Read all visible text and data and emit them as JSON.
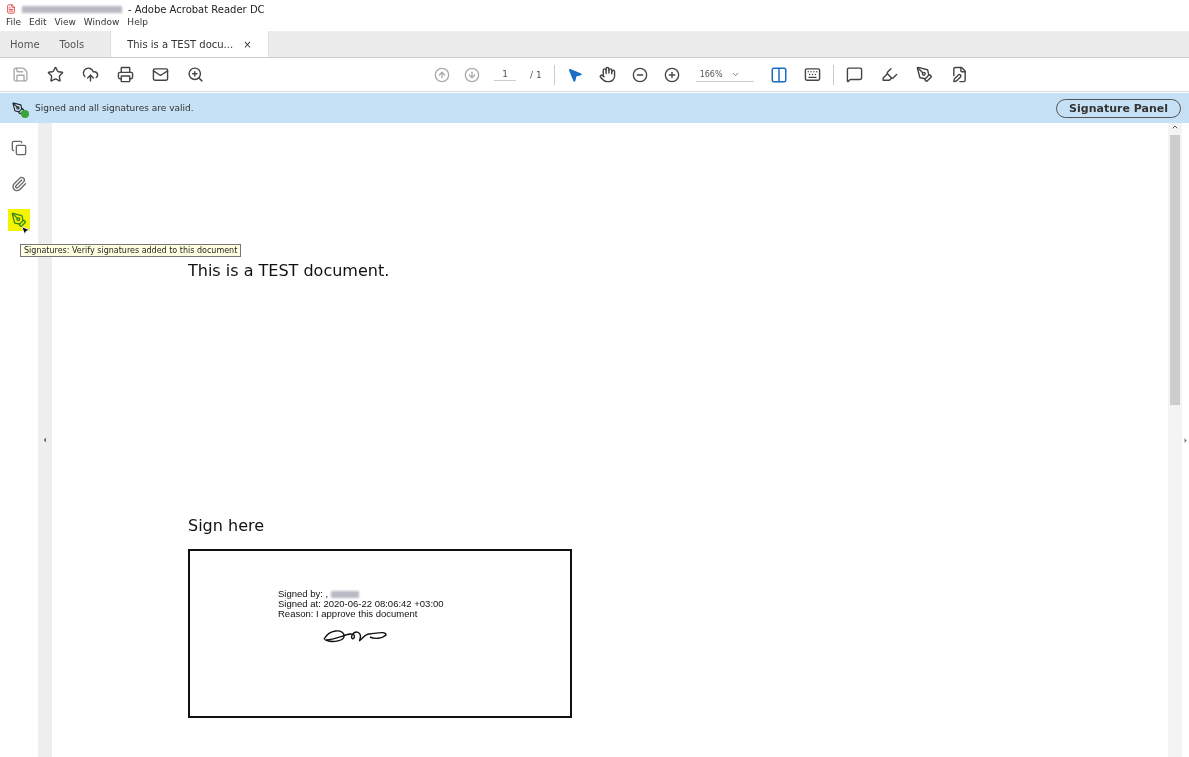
{
  "window": {
    "title": "- Adobe Acrobat Reader DC"
  },
  "menu": [
    "File",
    "Edit",
    "View",
    "Window",
    "Help"
  ],
  "tabs": [
    {
      "label": "Home",
      "selected": false
    },
    {
      "label": "Tools",
      "selected": false
    },
    {
      "label": "This is a TEST docu...",
      "selected": true,
      "close": "×"
    }
  ],
  "toolbar": {
    "page_nav": [
      {
        "kind": "up",
        "disabled": true
      },
      {
        "kind": "down",
        "disabled": true
      }
    ],
    "page_number": "1",
    "page_total": "/ 1",
    "zoom": "166%"
  },
  "signature_bar": {
    "message": "Signed and all signatures are valid.",
    "button": "Signature Panel"
  },
  "sidebar": {
    "items": [
      {
        "kind": "pages",
        "selected": false
      },
      {
        "kind": "attachments",
        "selected": false
      },
      {
        "kind": "signatures",
        "selected": true
      }
    ],
    "tooltip": "Signatures: Verify signatures added to this document"
  },
  "document": {
    "heading": "This is a TEST document.",
    "sign_label": "Sign here",
    "signature": {
      "lines": [
        "Signed by: ,",
        "Signed at: 2020-06-22 08:06:42 +03:00",
        "Reason: I approve this document"
      ]
    }
  }
}
